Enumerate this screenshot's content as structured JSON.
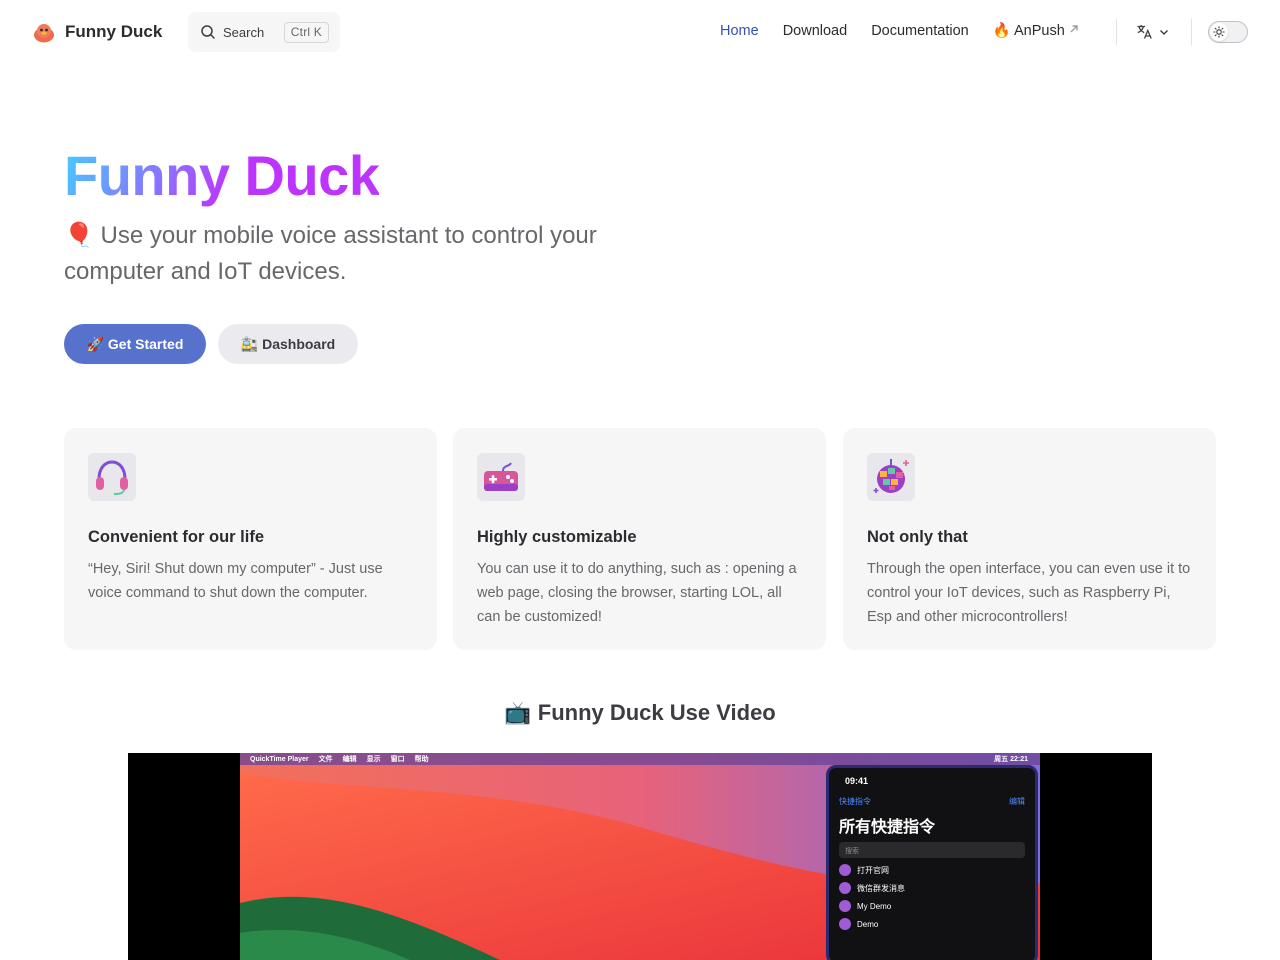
{
  "nav": {
    "brand": "Funny Duck",
    "search_label": "Search",
    "search_shortcut": "Ctrl K",
    "links": [
      {
        "label": "Home",
        "active": true
      },
      {
        "label": "Download"
      },
      {
        "label": "Documentation"
      },
      {
        "label": "🔥 AnPush",
        "external": true
      }
    ],
    "icons": [
      "duck-logo",
      "search-icon",
      "translate-icon",
      "chevron-down-icon",
      "sun-icon",
      "external-link-icon"
    ]
  },
  "hero": {
    "name": "Funny Duck",
    "tagline": "🎈 Use your mobile voice assistant to control your computer and IoT devices.",
    "actions": [
      {
        "label": "🚀 Get Started",
        "theme": "brand"
      },
      {
        "label": "🚉 Dashboard",
        "theme": "alt"
      }
    ]
  },
  "features": [
    {
      "icon": "headphones-icon",
      "title": "Convenient for our life",
      "details": "“Hey, Siri! Shut down my computer” - Just use voice command to shut down the computer."
    },
    {
      "icon": "game-controller-icon",
      "title": "Highly customizable",
      "details": "You can use it to do anything, such as : opening a web page, closing the browser, starting LOL, all can be customized!"
    },
    {
      "icon": "disco-ball-icon",
      "title": "Not only that",
      "details": "Through the open interface, you can even use it to control your IoT devices, such as Raspberry Pi, Esp and other microcontrollers!"
    }
  ],
  "video": {
    "heading": "📺 Funny Duck Use Video",
    "menubar_app": "QuickTime Player",
    "menubar_items": [
      "文件",
      "编辑",
      "显示",
      "窗口",
      "帮助"
    ],
    "menubar_clock": "周五 22:21",
    "phone": {
      "time": "09:41",
      "back": "快捷指令",
      "edit": "编辑",
      "title": "所有快捷指令",
      "search_placeholder": "搜索",
      "rows": [
        "打开官网",
        "微信群发消息",
        "My Demo",
        "Demo"
      ]
    }
  },
  "colors": {
    "brand": "#5672cd",
    "gradient_start": "#41d1ff",
    "gradient_end": "#bd34fe",
    "link_active": "#3451b2"
  }
}
